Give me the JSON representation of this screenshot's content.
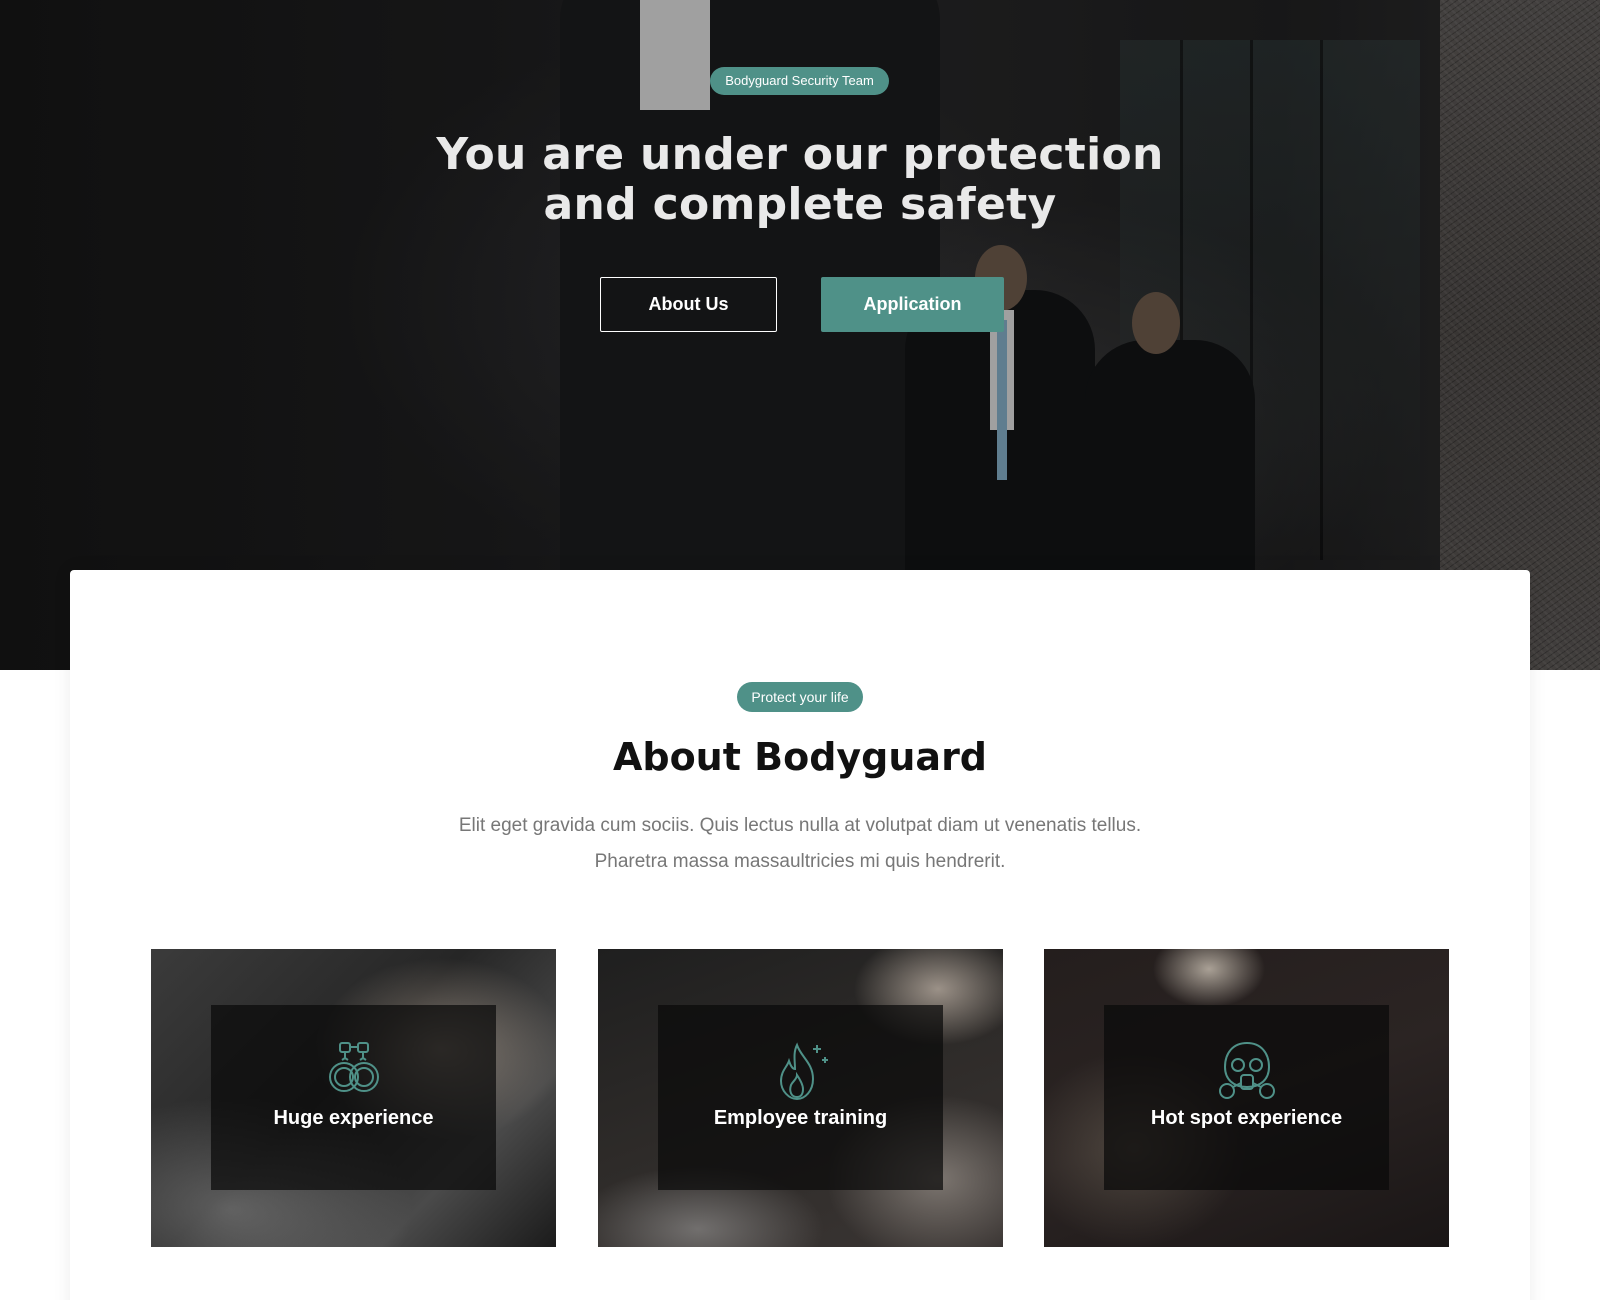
{
  "hero": {
    "badge": "Bodyguard Security Team",
    "title_line1": "You are under our protection",
    "title_line2": "and complete safety",
    "about_button": "About Us",
    "application_button": "Application"
  },
  "about": {
    "badge": "Protect your life",
    "title": "About Bodyguard",
    "text_line1": "Elit eget gravida cum sociis. Quis lectus nulla at volutpat diam ut venenatis tellus.",
    "text_line2": "Pharetra massa massaultricies mi quis hendrerit."
  },
  "features": [
    {
      "label": "Huge experience",
      "icon": "handcuffs-icon"
    },
    {
      "label": "Employee training",
      "icon": "fire-icon"
    },
    {
      "label": "Hot spot experience",
      "icon": "gas-mask-icon"
    }
  ],
  "colors": {
    "accent": "#4f9188",
    "heading": "#111111",
    "body_text": "#777777"
  }
}
